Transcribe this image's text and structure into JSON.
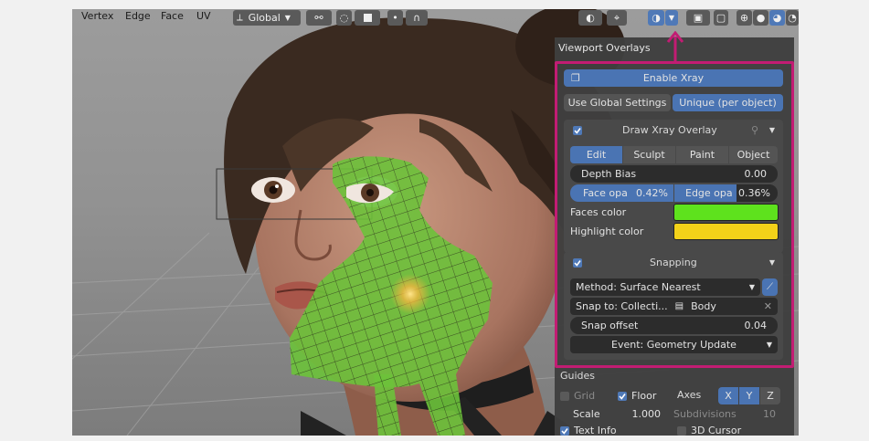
{
  "toolbar": {
    "menu": [
      "Vertex",
      "Edge",
      "Face",
      "UV"
    ],
    "orientation": "Global"
  },
  "overlay": {
    "title": "Viewport Overlays",
    "enable_xray": "Enable Xray",
    "use_global": "Use Global Settings",
    "unique": "Unique (per object)",
    "draw_xray_overlay": "Draw Xray Overlay",
    "modes": [
      "Edit",
      "Sculpt",
      "Paint",
      "Object"
    ],
    "depth_bias_label": "Depth Bias",
    "depth_bias_value": "0.00",
    "face_opa_label": "Face opa",
    "face_opa_value": "0.42%",
    "edge_opa_label": "Edge opa",
    "edge_opa_value": "0.36%",
    "faces_color_label": "Faces color",
    "faces_color": "#5ee21d",
    "highlight_color_label": "Highlight color",
    "highlight_color": "#f3d219",
    "snapping_title": "Snapping",
    "method": "Method: Surface Nearest",
    "snap_to": "Snap to: Collecti...",
    "snap_target": "Body",
    "snap_offset_label": "Snap offset",
    "snap_offset_value": "0.04",
    "event": "Event: Geometry Update"
  },
  "guides": {
    "title": "Guides",
    "grid": "Grid",
    "floor": "Floor",
    "axes": "Axes",
    "axis_x": "X",
    "axis_y": "Y",
    "axis_z": "Z",
    "scale_label": "Scale",
    "scale_value": "1.000",
    "subdivisions_label": "Subdivisions",
    "subdivisions_value": "10",
    "text_info": "Text Info",
    "cursor_3d": "3D Cursor"
  },
  "colors": {
    "highlight_border": "#c21c73",
    "selected_blue": "#4a74b3"
  }
}
